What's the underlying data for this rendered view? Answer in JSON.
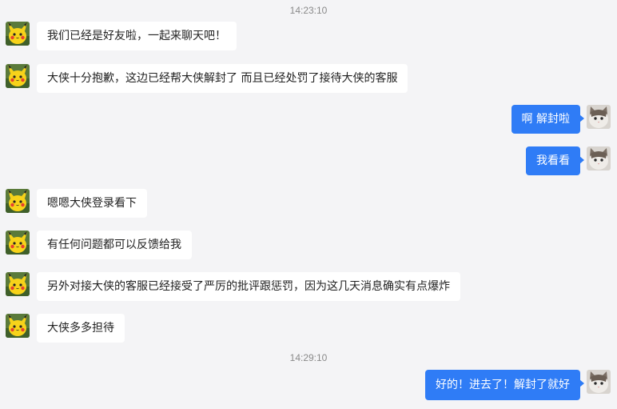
{
  "colors": {
    "background": "#f4f4f6",
    "incoming_bubble": "#ffffff",
    "outgoing_bubble": "#2f7cf6",
    "timestamp_text": "#8a8a8a"
  },
  "avatars": {
    "contact": "pikachu-avatar",
    "me": "cat-avatar"
  },
  "timestamps": [
    "14:23:10",
    "14:29:10"
  ],
  "messages": [
    {
      "side": "left",
      "text": "我们已经是好友啦，一起来聊天吧！"
    },
    {
      "side": "left",
      "text": "大侠十分抱歉，这边已经帮大侠解封了 而且已经处罚了接待大侠的客服"
    },
    {
      "side": "right",
      "text": "啊 解封啦"
    },
    {
      "side": "right",
      "text": "我看看"
    },
    {
      "side": "left",
      "text": "嗯嗯大侠登录看下"
    },
    {
      "side": "left",
      "text": "有任何问题都可以反馈给我"
    },
    {
      "side": "left",
      "text": "另外对接大侠的客服已经接受了严厉的批评跟惩罚，因为这几天消息确实有点爆炸"
    },
    {
      "side": "left",
      "text": "大侠多多担待"
    },
    {
      "side": "right",
      "text": "好的！进去了！解封了就好"
    }
  ]
}
